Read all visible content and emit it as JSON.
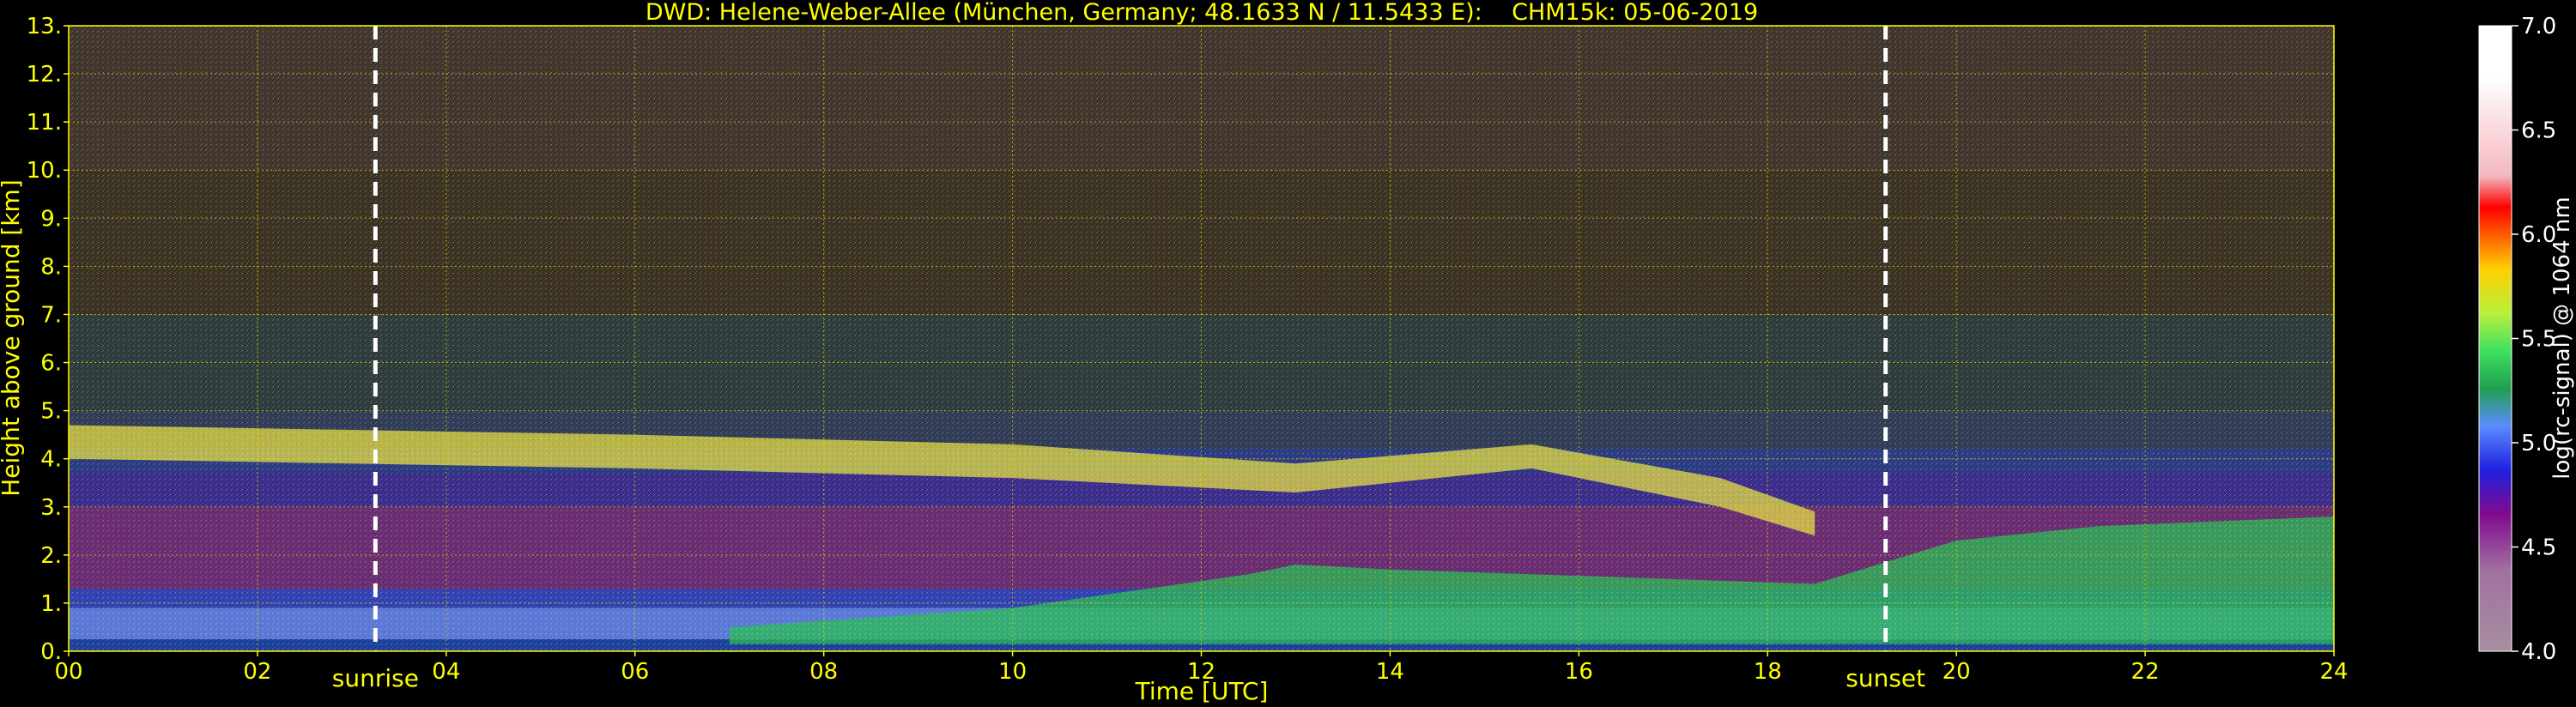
{
  "colors": {
    "background": "#000000",
    "text": "#ffff00",
    "grid": "#d4d400",
    "marker_line": "#ffffff",
    "colorbar_text": "#ffffff"
  },
  "chart_data": {
    "type": "heatmap",
    "title": "DWD: Helene-Weber-Allee (München, Germany; 48.1633 N / 11.5433 E):    CHM15k: 05-06-2019",
    "xlabel": "Time [UTC]",
    "ylabel": "Height above ground [km]",
    "xlim": [
      0,
      24
    ],
    "ylim": [
      0,
      13
    ],
    "x_ticks": [
      "00",
      "02",
      "04",
      "06",
      "08",
      "10",
      "12",
      "14",
      "16",
      "18",
      "20",
      "22",
      "24"
    ],
    "y_ticks": [
      "0.",
      "1.",
      "2.",
      "3.",
      "4.",
      "5.",
      "6.",
      "7.",
      "8.",
      "9.",
      "10.",
      "11.",
      "12.",
      "13."
    ],
    "grid": true,
    "markers": [
      {
        "label": "sunrise",
        "x": 3.25
      },
      {
        "label": "sunset",
        "x": 19.25
      }
    ],
    "colorbar": {
      "label": "log(rc-signal) @ 1064 nm",
      "range": [
        4.0,
        7.0
      ],
      "ticks": [
        "4.0",
        "4.5",
        "5.0",
        "5.5",
        "6.0",
        "6.5",
        "7.0"
      ]
    },
    "features": [
      {
        "name": "aerosol layer",
        "t": [
          0,
          3,
          6,
          10,
          13,
          15.5,
          17.5,
          18.5
        ],
        "top_km": [
          4.7,
          4.6,
          4.5,
          4.3,
          3.9,
          4.3,
          3.6,
          2.9
        ],
        "bottom_km": [
          4.0,
          3.9,
          3.8,
          3.6,
          3.3,
          3.8,
          3.0,
          2.4
        ],
        "value": 5.5
      },
      {
        "name": "convective boundary layer",
        "t": [
          7,
          10,
          12.5,
          13,
          14,
          17,
          18.5,
          20,
          21.5,
          24
        ],
        "top_km": [
          0.5,
          0.9,
          1.6,
          1.8,
          1.7,
          1.5,
          1.4,
          2.3,
          2.6,
          2.8
        ],
        "value": 5.3
      }
    ]
  }
}
